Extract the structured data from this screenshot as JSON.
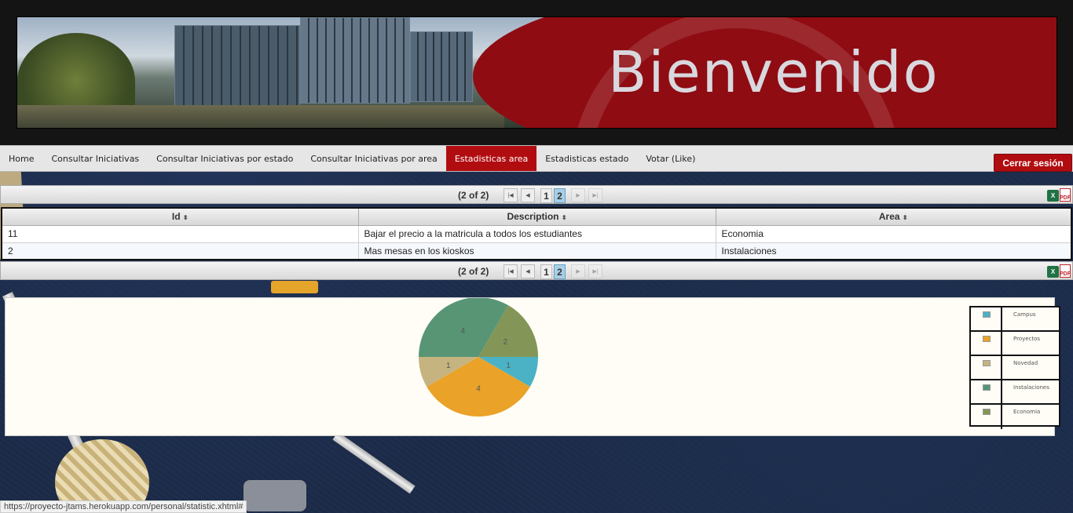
{
  "banner": {
    "title": "Bienvenido"
  },
  "menu": {
    "items": [
      {
        "label": "Home"
      },
      {
        "label": "Consultar Iniciativas"
      },
      {
        "label": "Consultar Iniciativas por estado"
      },
      {
        "label": "Consultar Iniciativas por area"
      },
      {
        "label": "Estadisticas area",
        "active": true
      },
      {
        "label": "Estadisticas estado"
      },
      {
        "label": "Votar (Like)"
      }
    ],
    "logout_label": "Cerrar sesión"
  },
  "paginator": {
    "current": "(2 of 2)",
    "first_icon": "first-page-icon",
    "prev_icon": "prev-page-icon",
    "next_icon": "next-page-icon",
    "last_icon": "last-page-icon",
    "pages": [
      "1",
      "2"
    ],
    "selected_page": "2",
    "export_excel_icon": "excel-icon",
    "export_pdf_icon": "pdf-icon"
  },
  "table": {
    "columns": [
      "Id",
      "Description",
      "Area"
    ],
    "rows": [
      {
        "id": "11",
        "description": "Bajar el precio a la matricula a todos los estudiantes",
        "area": "Economia"
      },
      {
        "id": "2",
        "description": "Mas mesas en los kioskos",
        "area": "Instalaciones"
      }
    ]
  },
  "chart_data": {
    "type": "pie",
    "categories": [
      "Campus",
      "Proyectos",
      "Novedad",
      "Instalaciones",
      "Economia"
    ],
    "values": [
      1,
      4,
      1,
      4,
      2
    ],
    "colors": [
      "#4bb2c5",
      "#eaa228",
      "#c5b47f",
      "#579575",
      "#839557"
    ],
    "legend": "right"
  },
  "status_url": "https://proyecto-jtams.herokuapp.com/personal/statistic.xhtml#"
}
